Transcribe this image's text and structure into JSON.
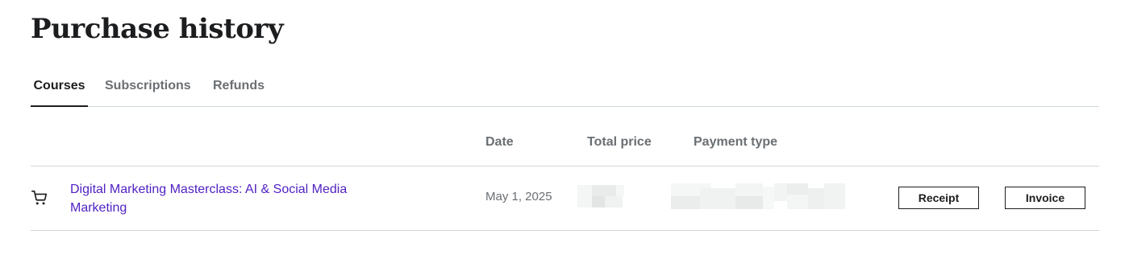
{
  "page": {
    "title": "Purchase history"
  },
  "tabs": [
    {
      "label": "Courses",
      "active": true
    },
    {
      "label": "Subscriptions",
      "active": false
    },
    {
      "label": "Refunds",
      "active": false
    }
  ],
  "table": {
    "headers": {
      "date": "Date",
      "total_price": "Total price",
      "payment_type": "Payment type"
    },
    "rows": [
      {
        "icon": "shopping-cart-icon",
        "course_title": "Digital Marketing Masterclass: AI & Social Media Marketing",
        "date": "May 1, 2025",
        "receipt_label": "Receipt",
        "invoice_label": "Invoice"
      }
    ]
  },
  "colors": {
    "link": "#5022c3",
    "text": "#1c1d1f",
    "muted": "#6a6f73",
    "border": "#d1d7dc"
  }
}
